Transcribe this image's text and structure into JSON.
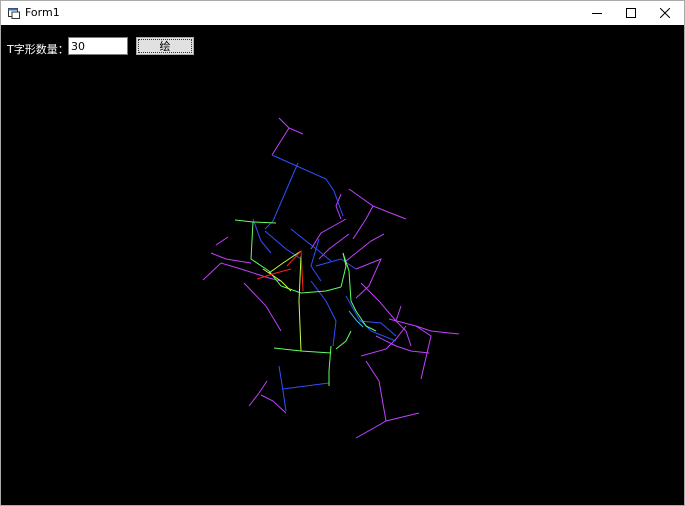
{
  "window": {
    "title": "Form1"
  },
  "form": {
    "count_label": "T字形数量：",
    "count_value": "30",
    "draw_button_label": "绘"
  },
  "colors": {
    "background": "#000000",
    "purple": "#c040ff",
    "blue": "#3050ff",
    "green": "#60ff60",
    "yellow_green": "#c0ff40",
    "red": "#ff2020",
    "cyan": "#40c0e0"
  }
}
